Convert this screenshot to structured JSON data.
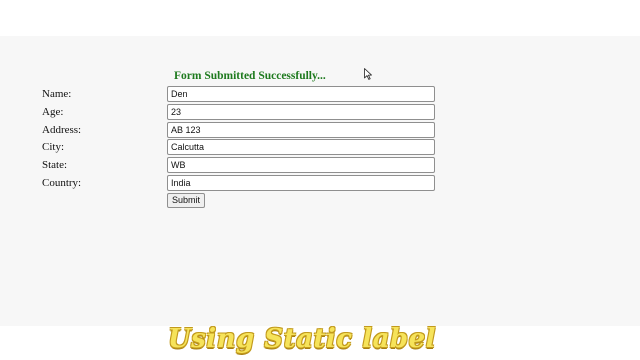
{
  "form": {
    "success_message": "Form Submitted Successfully...",
    "fields": [
      {
        "label": "Name:",
        "value": "Den"
      },
      {
        "label": "Age:",
        "value": "23"
      },
      {
        "label": "Address:",
        "value": "AB 123"
      },
      {
        "label": "City:",
        "value": "Calcutta"
      },
      {
        "label": "State:",
        "value": "WB"
      },
      {
        "label": "Country:",
        "value": "India"
      }
    ],
    "submit_label": "Submit"
  },
  "caption": {
    "text": "Using Static label",
    "color": "#f6e35a"
  },
  "colors": {
    "success": "#1e7a1e",
    "page_background": "#f7f7f7"
  },
  "icons": {
    "cursor": "mouse-pointer-icon"
  }
}
